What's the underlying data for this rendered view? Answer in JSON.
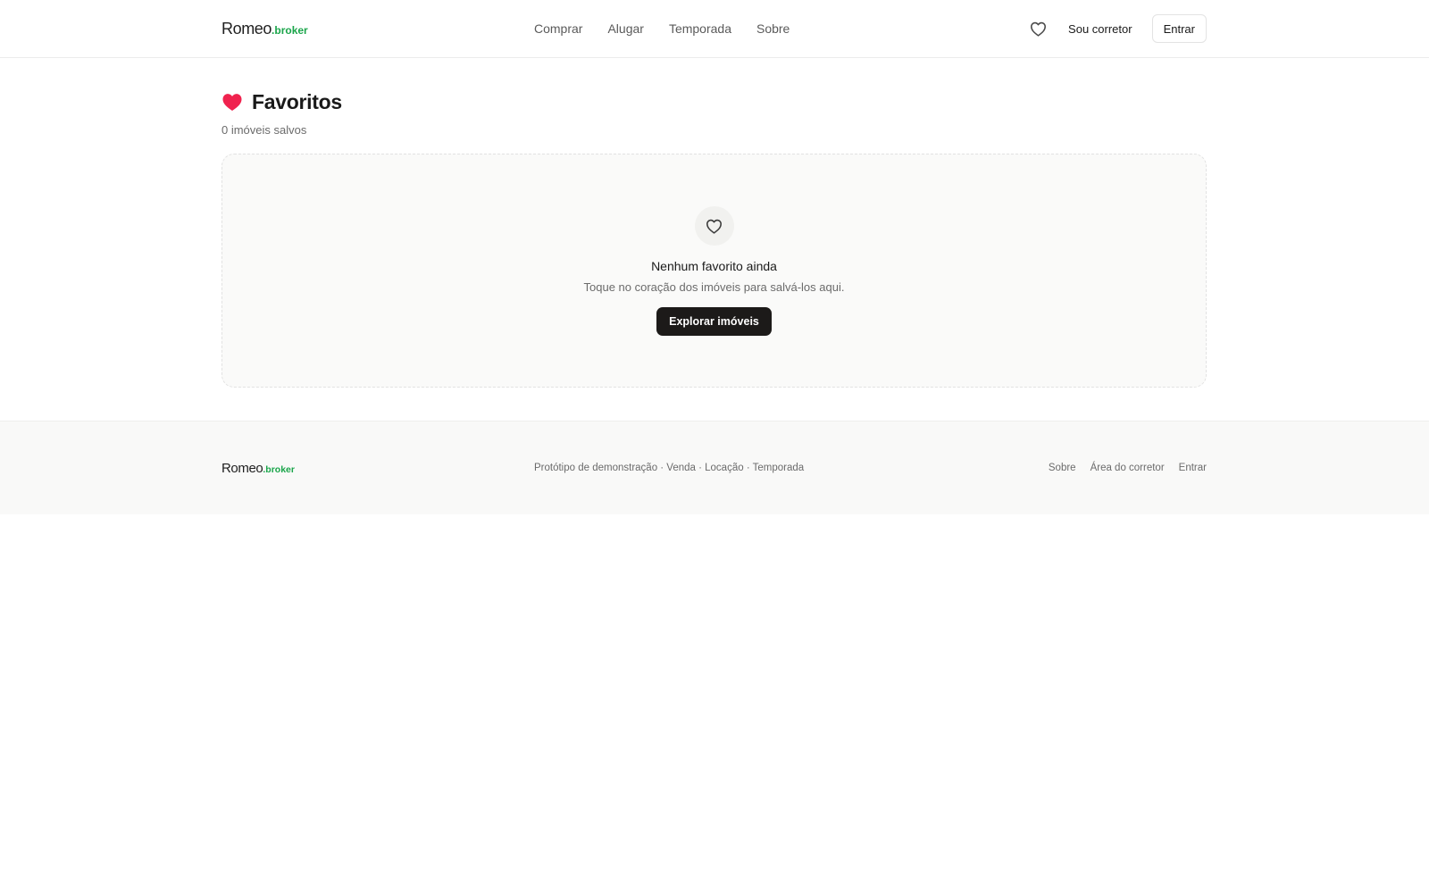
{
  "brand": {
    "name": "Romeo",
    "suffix": ".broker",
    "accent_color": "#1aa54a"
  },
  "header": {
    "nav": [
      "Comprar",
      "Alugar",
      "Temporada",
      "Sobre"
    ],
    "favorites_icon": "heart-outline-icon",
    "broker_link": "Sou corretor",
    "login_button": "Entrar"
  },
  "page": {
    "title": "Favoritos",
    "title_icon": "heart-filled-icon",
    "title_icon_color": "#f0224e",
    "subtitle": "0 imóveis salvos"
  },
  "empty_state": {
    "icon": "heart-outline-icon",
    "title": "Nenhum favorito ainda",
    "description": "Toque no coração dos imóveis para salvá-los aqui.",
    "button": "Explorar imóveis"
  },
  "footer": {
    "tagline": "Protótipo de demonstração · Venda · Locação · Temporada",
    "links": [
      "Sobre",
      "Área do corretor",
      "Entrar"
    ]
  }
}
